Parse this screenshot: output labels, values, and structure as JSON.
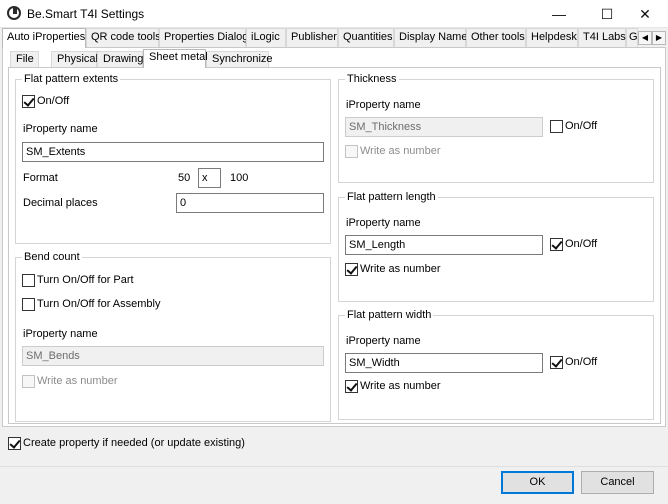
{
  "window": {
    "title": "Be.Smart T4I Settings",
    "minimize_glyph": "—",
    "maximize_glyph": "☐",
    "close_glyph": "✕"
  },
  "tabs": [
    {
      "label": "Auto iProperties"
    },
    {
      "label": "QR code tools"
    },
    {
      "label": "Properties Dialog"
    },
    {
      "label": "iLogic"
    },
    {
      "label": "Publisher"
    },
    {
      "label": "Quantities"
    },
    {
      "label": "Display Name"
    },
    {
      "label": "Other tools"
    },
    {
      "label": "Helpdesk"
    },
    {
      "label": "T4I Labs"
    },
    {
      "label": "G"
    }
  ],
  "subtabs": [
    {
      "label": "File"
    },
    {
      "label": "Physical"
    },
    {
      "label": "Drawing"
    },
    {
      "label": "Sheet metal"
    },
    {
      "label": "Synchronize"
    }
  ],
  "extents": {
    "title": "Flat pattern extents",
    "onoff_label": "On/Off",
    "onoff_checked": true,
    "iproperty_label": "iProperty name",
    "iproperty_value": "SM_Extents",
    "format_label": "Format",
    "format_left": "50",
    "format_sep": "x",
    "format_right": "100",
    "decimal_label": "Decimal places",
    "decimal_value": "0"
  },
  "bend": {
    "title": "Bend count",
    "part_label": "Turn On/Off for Part",
    "assembly_label": "Turn On/Off for Assembly",
    "iproperty_label": "iProperty name",
    "iproperty_value": "SM_Bends",
    "write_label": "Write as number"
  },
  "thickness": {
    "title": "Thickness",
    "iproperty_label": "iProperty name",
    "iproperty_value": "SM_Thickness",
    "onoff_label": "On/Off",
    "write_label": "Write as number"
  },
  "length": {
    "title": "Flat pattern length",
    "iproperty_label": "iProperty name",
    "iproperty_value": "SM_Length",
    "onoff_label": "On/Off",
    "write_label": "Write as number"
  },
  "width": {
    "title": "Flat pattern width",
    "iproperty_label": "iProperty name",
    "iproperty_value": "SM_Width",
    "onoff_label": "On/Off",
    "write_label": "Write as number"
  },
  "footer": {
    "create_label": "Create property if needed (or update existing)",
    "ok_label": "OK",
    "cancel_label": "Cancel"
  }
}
